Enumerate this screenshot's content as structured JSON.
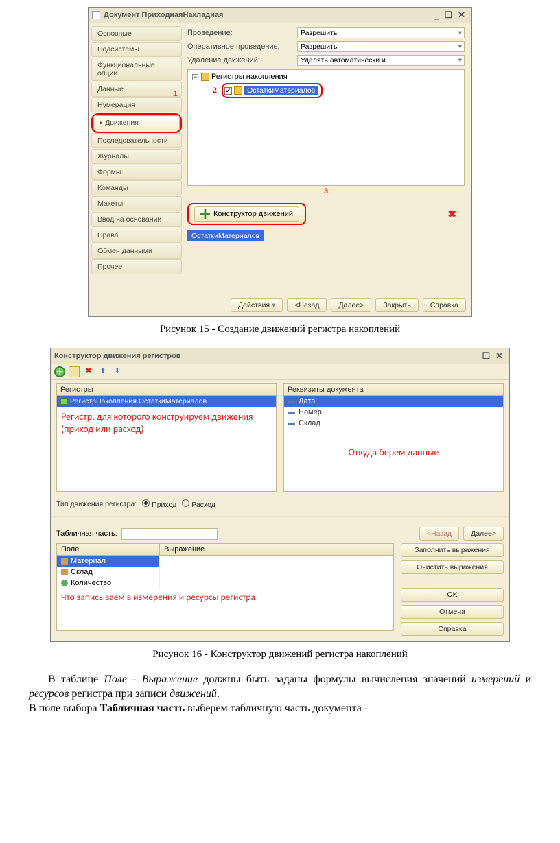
{
  "fig15": {
    "title": "Документ  ПриходнаяНакладная",
    "sidebar": [
      "Основные",
      "Подсистемы",
      "Функциональные опции",
      "Данные",
      "Нумерация",
      "Движения",
      "Последовательности",
      "Журналы",
      "Формы",
      "Команды",
      "Макеты",
      "Ввод на основании",
      "Права",
      "Обмен данными",
      "Прочее"
    ],
    "active_index": 5,
    "props": {
      "p1_label": "Проведение:",
      "p1_value": "Разрешить",
      "p2_label": "Оперативное проведение:",
      "p2_value": "Разрешить",
      "p3_label": "Удаление движений:",
      "p3_value": "Удалять автоматически и"
    },
    "tree_root": "Регистры накопления",
    "tree_child": "ОстаткиМатериалов",
    "ann1": "1",
    "ann2": "2",
    "ann3": "3",
    "constructor_btn": "Конструктор движений",
    "blue_tab": "ОстаткиМатериалов",
    "footer": {
      "actions": "Действия",
      "back": "<Назад",
      "next": "Далее>",
      "close": "Закрыть",
      "help": "Справка"
    },
    "caption": "Рисунок 15 - Создание движений регистра накоплений"
  },
  "fig16": {
    "title": "Конструктор движения регистров",
    "panel_reg_head": "Регистры",
    "panel_reg_row": "РегистрНакопления.ОстаткиМатериалов",
    "panel_reg_note": "Регистр, для которого конструируем движения (приход или расход)",
    "panel_attr_head": "Реквизиты документа",
    "attrs": [
      "Дата",
      "Номер",
      "Склад"
    ],
    "panel_attr_note": "Откуда берем данные",
    "type_label": "Тип движения регистра:",
    "type_opt1": "Приход",
    "type_opt2": "Расход",
    "tab_part_label": "Табличная часть:",
    "btn_back": "<Назад",
    "btn_next": "Далее>",
    "btn_fill": "Заполнить выражения",
    "btn_clear": "Очистить выражения",
    "btn_ok": "OK",
    "btn_cancel": "Отмена",
    "btn_help": "Справка",
    "grid_h1": "Поле",
    "grid_h2": "Выражение",
    "grid_rows": [
      "Материал",
      "Склад",
      "Количество"
    ],
    "grid_note": "Что записываем в измерения и ресурсы регистра",
    "caption": "Рисунок 16 - Конструктор движений регистра накоплений"
  },
  "body_text": {
    "p1a": "В таблице ",
    "p1b": "Поле - Выражение",
    "p1c": " должны быть заданы формулы вычисления значений ",
    "p1d": "измерений",
    "p1e": " и ",
    "p1f": "ресурсов",
    "p1g": " регистра при записи ",
    "p1h": "движений",
    "p1i": ".",
    "p2a": "В поле выбора ",
    "p2b": "Табличная часть",
    "p2c": " выберем табличную часть документа -"
  }
}
